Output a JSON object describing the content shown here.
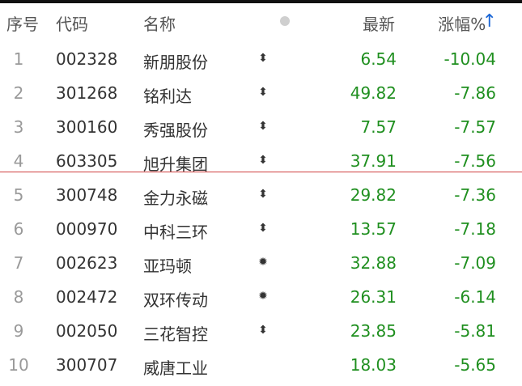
{
  "header": {
    "index": "序号",
    "code": "代码",
    "name": "名称",
    "price": "最新",
    "change": "涨幅%",
    "sort_arrow": "↑"
  },
  "colors": {
    "down_green": "#1f8f1f",
    "divider_red": "#d04040",
    "sort_blue": "#1a66d6"
  },
  "rows": [
    {
      "index": "1",
      "code": "002328",
      "name": "新朋股份",
      "mark": "⬍",
      "price": "6.54",
      "change": "-10.04"
    },
    {
      "index": "2",
      "code": "301268",
      "name": "铭利达",
      "mark": "⬍",
      "price": "49.82",
      "change": "-7.86"
    },
    {
      "index": "3",
      "code": "300160",
      "name": "秀强股份",
      "mark": "⬍",
      "price": "7.57",
      "change": "-7.57"
    },
    {
      "index": "4",
      "code": "603305",
      "name": "旭升集团",
      "mark": "⬍",
      "price": "37.91",
      "change": "-7.56"
    },
    {
      "index": "5",
      "code": "300748",
      "name": "金力永磁",
      "mark": "⬍",
      "price": "29.82",
      "change": "-7.36"
    },
    {
      "index": "6",
      "code": "000970",
      "name": "中科三环",
      "mark": "⬍",
      "price": "13.57",
      "change": "-7.18"
    },
    {
      "index": "7",
      "code": "002623",
      "name": "亚玛顿",
      "mark": "✹",
      "price": "32.88",
      "change": "-7.09"
    },
    {
      "index": "8",
      "code": "002472",
      "name": "双环传动",
      "mark": "✹",
      "price": "26.31",
      "change": "-6.14"
    },
    {
      "index": "9",
      "code": "002050",
      "name": "三花智控",
      "mark": "⬍",
      "price": "23.85",
      "change": "-5.81"
    },
    {
      "index": "10",
      "code": "300707",
      "name": "威唐工业",
      "mark": "",
      "price": "18.03",
      "change": "-5.65"
    }
  ]
}
